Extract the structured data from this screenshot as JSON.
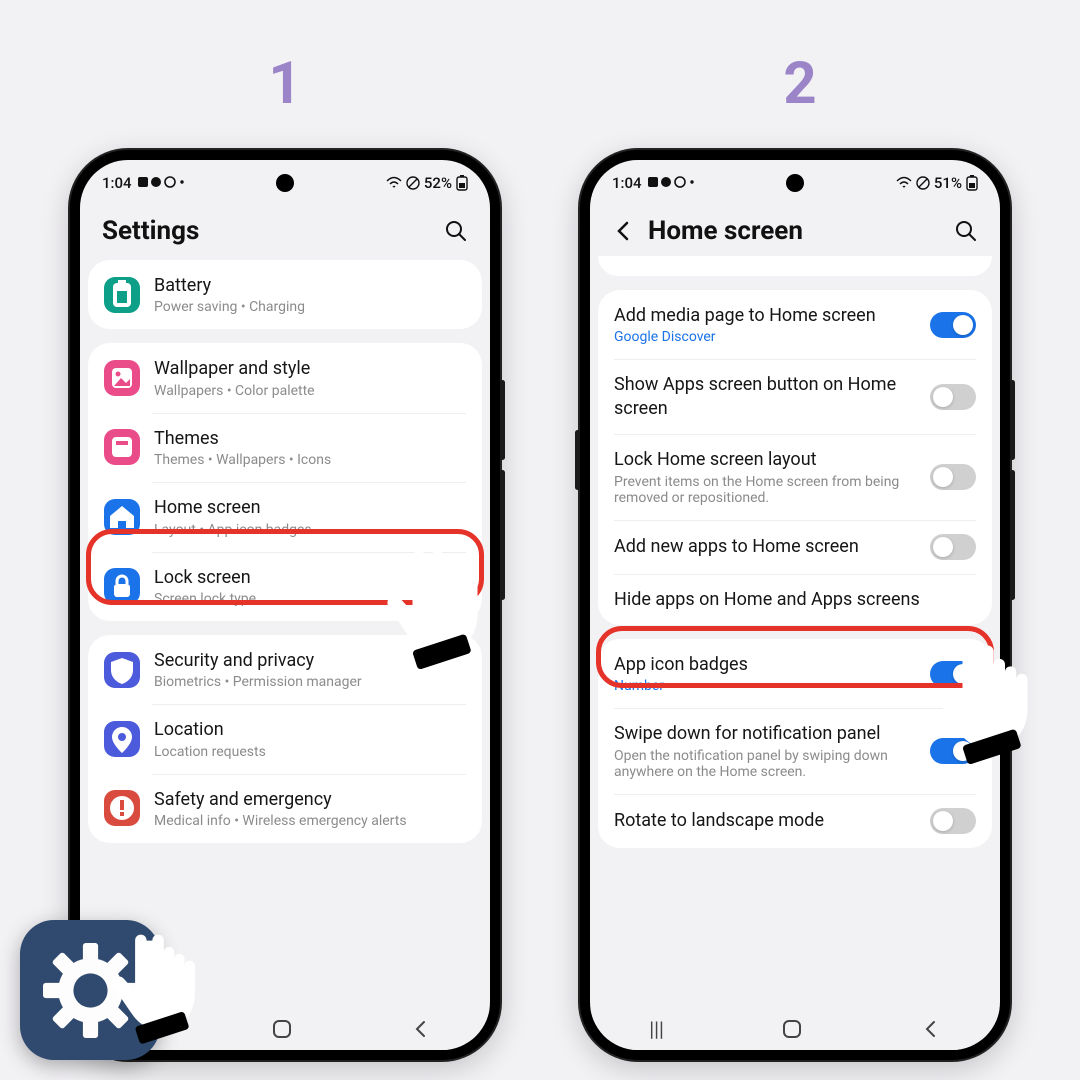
{
  "steps": {
    "one": "1",
    "two": "2"
  },
  "status": {
    "time": "1:04",
    "battery1": "52%",
    "battery2": "51%"
  },
  "phone1": {
    "title": "Settings",
    "groups": [
      [
        {
          "label": "Battery",
          "sub": "Power saving  •  Charging",
          "color": "#0d9f87",
          "icon": "battery"
        }
      ],
      [
        {
          "label": "Wallpaper and style",
          "sub": "Wallpapers  •  Color palette",
          "color": "#ea4c89",
          "icon": "wallpaper"
        },
        {
          "label": "Themes",
          "sub": "Themes  •  Wallpapers  •  Icons",
          "color": "#ea4c89",
          "icon": "themes"
        },
        {
          "label": "Home screen",
          "sub": "Layout  •  App icon badges",
          "color": "#1a73e8",
          "icon": "home"
        },
        {
          "label": "Lock screen",
          "sub": "Screen lock type",
          "color": "#1a73e8",
          "icon": "lock"
        }
      ],
      [
        {
          "label": "Security and privacy",
          "sub": "Biometrics  •  Permission manager",
          "color": "#4b5bdc",
          "icon": "shield"
        },
        {
          "label": "Location",
          "sub": "Location requests",
          "color": "#4b5bdc",
          "icon": "location"
        },
        {
          "label": "Safety and emergency",
          "sub": "Medical info  •  Wireless emergency alerts",
          "color": "#d94b3f",
          "icon": "sos"
        }
      ]
    ]
  },
  "phone2": {
    "title": "Home screen",
    "groups": [
      [
        {
          "label": "Add media page to Home screen",
          "sub": "Google Discover",
          "sublink": true,
          "toggle": "on"
        },
        {
          "label": "Show Apps screen button on Home screen",
          "toggle": "off"
        },
        {
          "label": "Lock Home screen layout",
          "sub": "Prevent items on the Home screen from being removed or repositioned.",
          "toggle": "off"
        },
        {
          "label": "Add new apps to Home screen",
          "toggle": "off"
        },
        {
          "label": "Hide apps on Home and Apps screens"
        }
      ],
      [
        {
          "label": "App icon badges",
          "sub": "Number",
          "sublink": true,
          "toggle": "on"
        },
        {
          "label": "Swipe down for notification panel",
          "sub": "Open the notification panel by swiping down anywhere on the Home screen.",
          "toggle": "on"
        },
        {
          "label": "Rotate to landscape mode",
          "toggle": "off"
        }
      ]
    ]
  }
}
